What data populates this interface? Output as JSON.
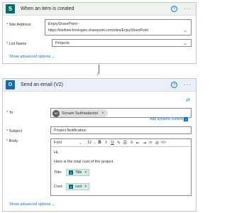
{
  "trigger": {
    "title": "When an item is created",
    "icon": "sharepoint-icon",
    "site_address_label": "Site Address",
    "site_address_line1": "EnjoySharePoint -",
    "site_address_line2": "https://tsinfotechnologies.sharepoint.com/sites/EnjoySharePoint",
    "list_name_label": "List Name",
    "list_name_value": "Projects",
    "advanced_options": "Show advanced options",
    "required_marker": "*"
  },
  "action": {
    "title": "Send an email (V2)",
    "icon": "outlook-icon",
    "to_label": "To",
    "to_recipient": "Sonam Subhadarsini",
    "to_initials": "SS",
    "add_dynamic_content": "Add dynamic content",
    "subject_label": "Subject",
    "subject_value": "Project Notification",
    "body_label": "Body",
    "toolbar": {
      "font": "Font",
      "size": "12",
      "bold": "B",
      "italic": "I",
      "underline": "U"
    },
    "body_line1": "Hi,",
    "body_line2": "Here is the total cost of the project.",
    "title_prefix": "Title:",
    "title_token": "Title",
    "cost_prefix": "Cost:",
    "cost_token": "cost",
    "advanced_options": "Show advanced options",
    "required_marker": "*"
  },
  "colors": {
    "accent": "#0078d4",
    "sharepoint": "#036c70",
    "outlook": "#0f6cbd",
    "required": "#a4262c"
  }
}
